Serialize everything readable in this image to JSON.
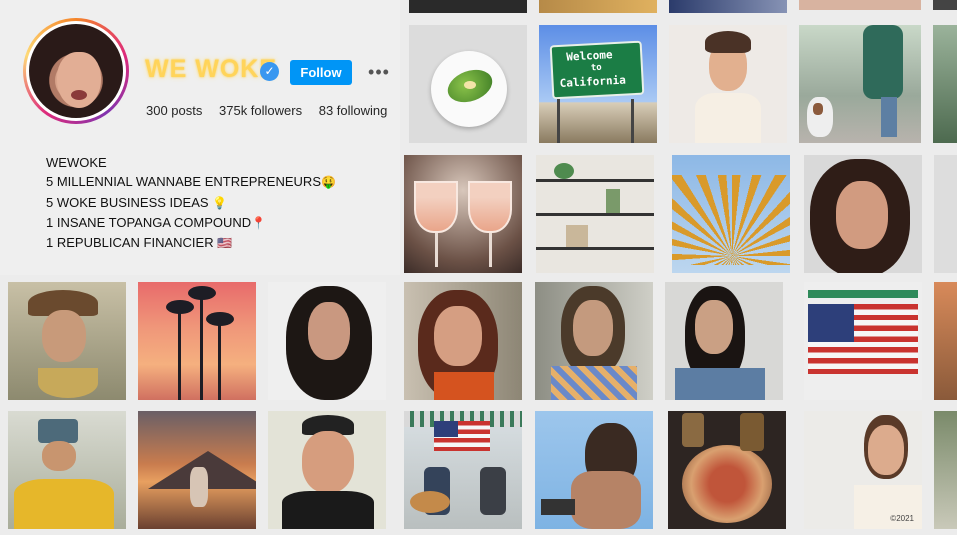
{
  "profile": {
    "username": "WE WOKE",
    "verified_icon": "verified-badge-icon",
    "follow_label": "Follow",
    "more_label": "•••",
    "stats": {
      "posts": "300 posts",
      "followers": "375k followers",
      "following": "83 following"
    },
    "bio": [
      {
        "text": "WEWOKE",
        "emoji": ""
      },
      {
        "text": "5 MILLENNIAL WANNABE ENTREPRENEURS",
        "emoji": "🤑"
      },
      {
        "text": "5 WOKE BUSINESS IDEAS ",
        "emoji": "💡"
      },
      {
        "text": "1  INSANE TOPANGA COMPOUND",
        "emoji": "📍"
      },
      {
        "text": "1 REPUBLICAN FINANCIER  ",
        "emoji": "🇺🇸"
      }
    ]
  },
  "photos": {
    "sign_line1": "Welcome",
    "sign_line2": "to",
    "sign_line3": "California",
    "copyright": "©2021"
  },
  "colors": {
    "follow": "#0095f6",
    "verified": "#3897f0",
    "username": "#ffd45a"
  }
}
